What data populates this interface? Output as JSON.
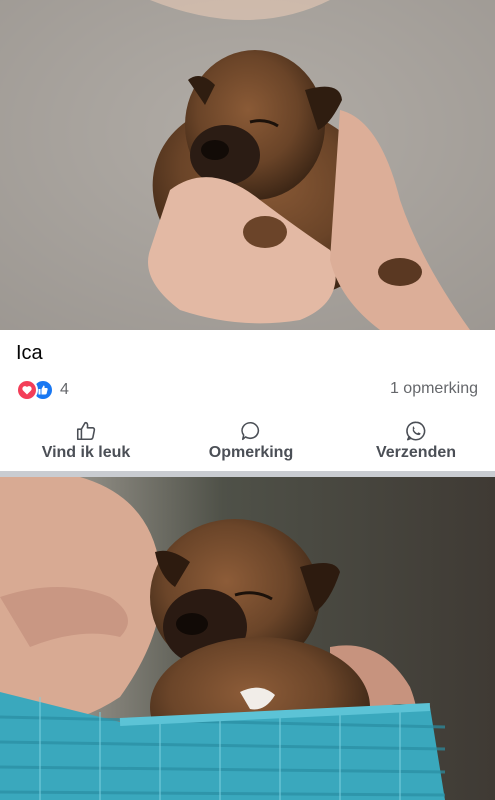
{
  "post": {
    "caption": "Ica",
    "reaction_count": "4",
    "comment_count": "1 opmerking",
    "reactions": [
      "love-icon",
      "like-icon"
    ]
  },
  "actions": {
    "like_label": "Vind ik leuk",
    "comment_label": "Opmerking",
    "send_label": "Verzenden"
  },
  "colors": {
    "love": "#f33e58",
    "like": "#1877f2",
    "secondary_text": "#65676b",
    "divider": "#c9ccd1"
  }
}
